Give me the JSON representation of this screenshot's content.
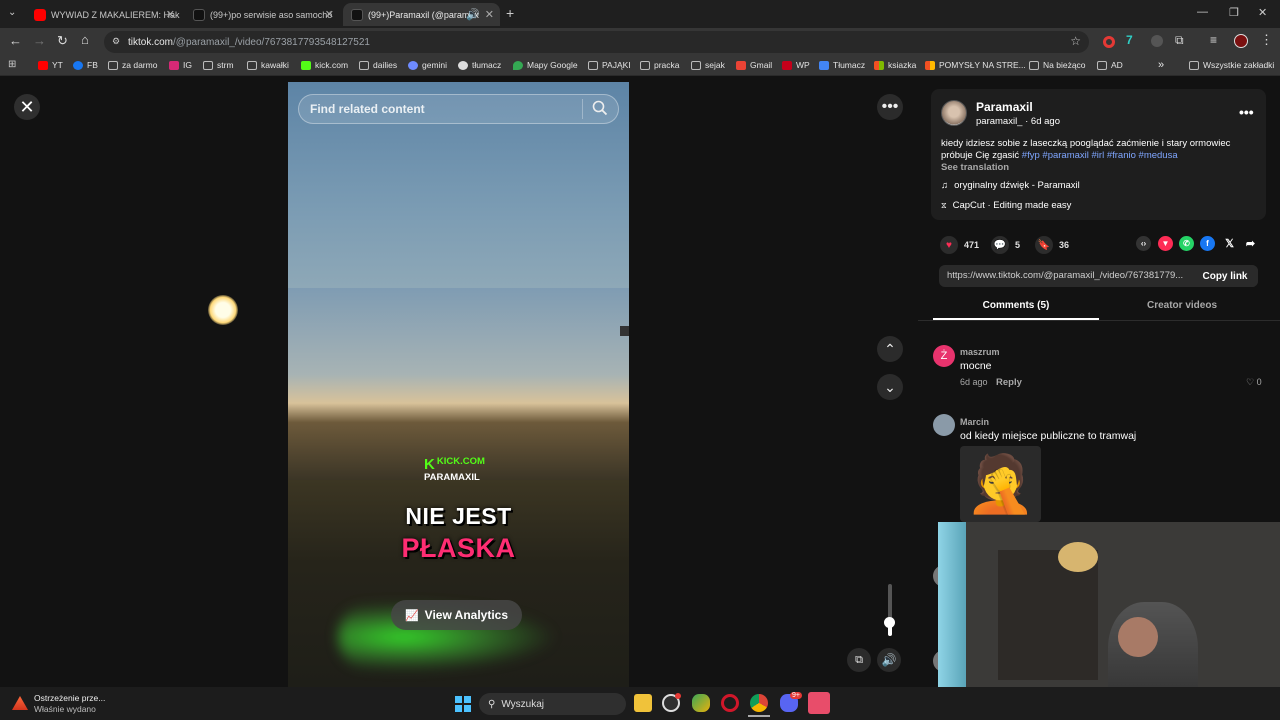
{
  "browser": {
    "tabs": [
      {
        "label": "WYWIAD Z MAKALIEREM: Hak",
        "active": false
      },
      {
        "label": "(99+)po serwisie aso samochó",
        "active": false
      },
      {
        "label": "(99+)Paramaxil (@paramax",
        "active": true
      }
    ],
    "new_tab": "+",
    "url_host": "tiktok.com",
    "url_path": "/@paramaxil_/video/7673817793548127521",
    "bookmarks": [
      "YT",
      "FB",
      "za darmo",
      "IG",
      "strm",
      "kawałki",
      "kick.com",
      "dailies",
      "gemini",
      "tłumacz",
      "Mapy Google",
      "PAJĄKI",
      "pracka",
      "sejak",
      "Gmail",
      "WP",
      "Tłumacz",
      "ksiazka",
      "POMYSŁY NA STRE...",
      "Na bieżąco",
      "AD"
    ],
    "bookmarks_more": "»",
    "all_bookmarks": "Wszystkie zakładki"
  },
  "video": {
    "search_placeholder": "Find related content",
    "watermark_top": "KICK.COM",
    "watermark_bottom": "PARAMAXIL",
    "caption_line1": "NIE JEST",
    "caption_line2": "PŁASKA",
    "analytics_label": "View Analytics",
    "volume_level": 0.1
  },
  "post": {
    "author_name": "Paramaxil",
    "author_handle": "paramaxil_",
    "posted": "6d ago",
    "description": "kiedy idziesz sobie z laseczką pooglądać zaćmienie i stary ormowiec próbuje Cię zgasić",
    "hashtags": [
      "#fyp",
      "#paramaxil",
      "#irl",
      "#franio",
      "#medusa"
    ],
    "see_translation": "See translation",
    "sound": "oryginalny dźwięk - Paramaxil",
    "capcut": "CapCut · Editing made easy",
    "likes": "471",
    "comments": "5",
    "saves": "36",
    "link": "https://www.tiktok.com/@paramaxil_/video/767381779...",
    "copy_link": "Copy link",
    "share_icons": [
      "embed-icon",
      "tiktok-friends-icon",
      "whatsapp-icon",
      "facebook-icon",
      "x-icon",
      "share-arrow-icon"
    ]
  },
  "tabs_panel": {
    "comments_tab": "Comments (5)",
    "creator_tab": "Creator videos"
  },
  "comments": [
    {
      "author": "maszrum",
      "avatar_letter": "Ż",
      "text": "mocne",
      "time": "6d ago",
      "reply": "Reply",
      "likes": "0"
    },
    {
      "author": "Marcin",
      "text": "od kiedy miejsce publiczne to tramwaj",
      "emoji": "🤦"
    }
  ],
  "taskbar": {
    "notification_title": "Ostrzeżenie prze...",
    "notification_sub": "Właśnie wydano",
    "search": "Wyszukaj",
    "discord_badge": "9+"
  },
  "colors": {
    "accent_pink": "#fe2c55",
    "hashtag_blue": "#7fa6ff",
    "kick_green": "#53fc18",
    "caption_pink": "#ff2d73"
  }
}
